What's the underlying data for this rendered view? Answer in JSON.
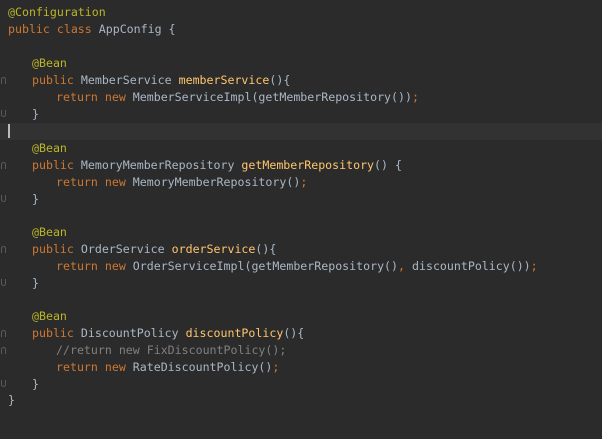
{
  "editor": {
    "colors": {
      "background": "#2b2b2b",
      "text": "#a9b7c6",
      "keyword": "#cc7832",
      "annotation": "#bbb529",
      "method": "#ffc66d",
      "comment": "#808080"
    },
    "code": {
      "l1": {
        "ann": "@Configuration"
      },
      "l2": {
        "kw": "public class ",
        "name": "AppConfig {"
      },
      "l4": {
        "ann": "@Bean"
      },
      "l5": {
        "kw": "public ",
        "type": "MemberService ",
        "fn": "memberService",
        "rest": "(){"
      },
      "l6": {
        "kw": "return new ",
        "rest": "MemberServiceImpl(getMemberRepository())",
        "semi": ";"
      },
      "l7": {
        "text": "}"
      },
      "l9": {
        "ann": "@Bean"
      },
      "l10": {
        "kw": "public ",
        "type": "MemoryMemberRepository ",
        "fn": "getMemberRepository",
        "rest": "() {"
      },
      "l11": {
        "kw": "return new ",
        "rest": "MemoryMemberRepository()",
        "semi": ";"
      },
      "l12": {
        "text": "}"
      },
      "l14": {
        "ann": "@Bean"
      },
      "l15": {
        "kw": "public ",
        "type": "OrderService ",
        "fn": "orderService",
        "rest": "(){"
      },
      "l16": {
        "kw": "return new ",
        "rest1": "OrderServiceImpl(getMemberRepository()",
        "comma": ", ",
        "rest2": "discountPolicy())",
        "semi": ";"
      },
      "l17": {
        "text": "}"
      },
      "l19": {
        "ann": "@Bean"
      },
      "l20": {
        "kw": "public ",
        "type": "DiscountPolicy ",
        "fn": "discountPolicy",
        "rest": "(){"
      },
      "l21": {
        "comment": "//return new FixDiscountPolicy();"
      },
      "l22": {
        "kw": "return new ",
        "rest": "RateDiscountPolicy()",
        "semi": ";"
      },
      "l23": {
        "text": "}"
      },
      "l24": {
        "text": "}"
      }
    }
  }
}
